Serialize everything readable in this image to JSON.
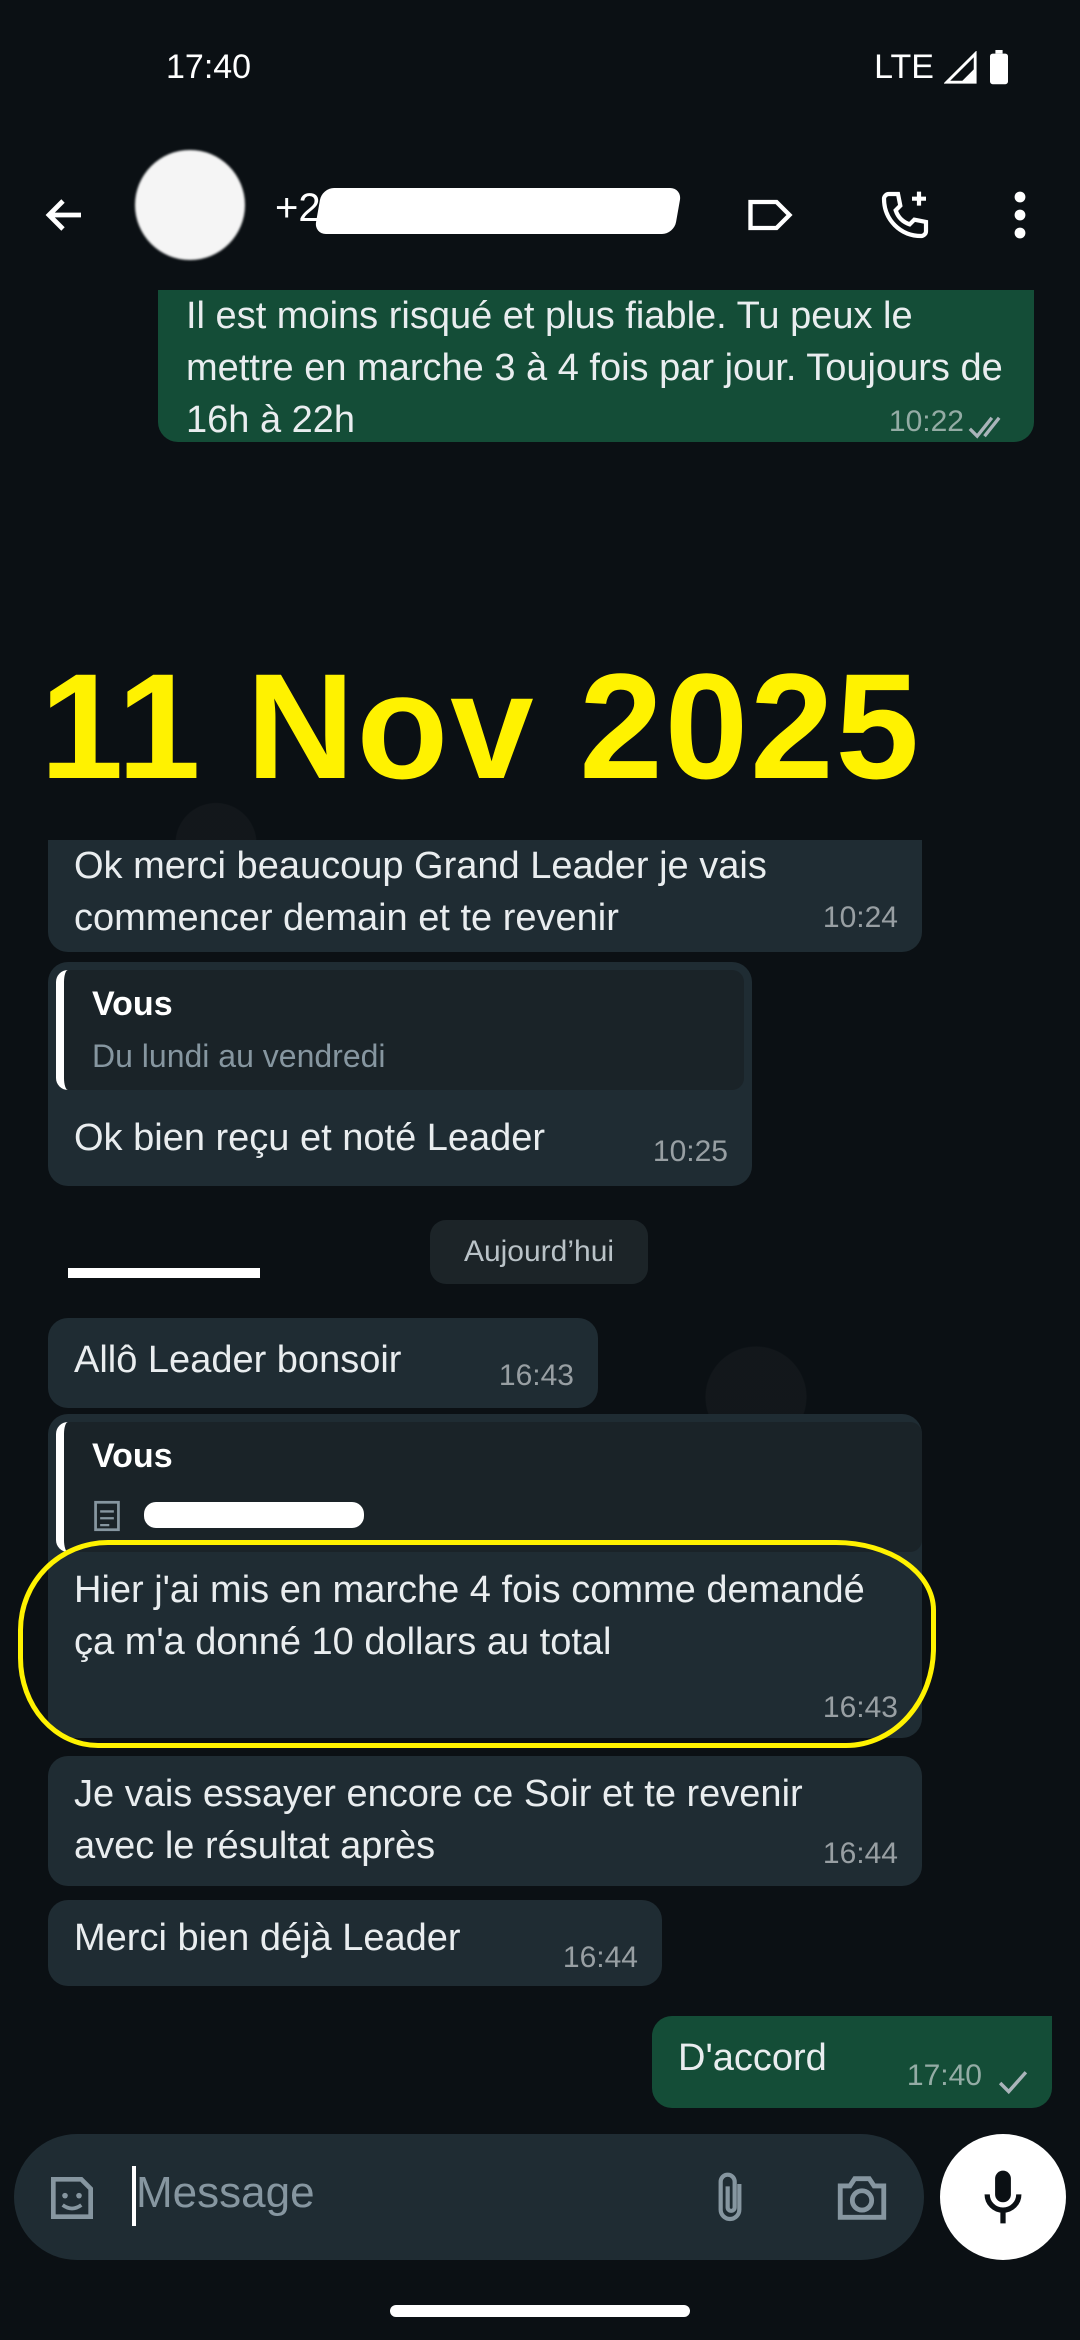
{
  "status": {
    "time": "17:40",
    "network": "LTE"
  },
  "header": {
    "contact_prefix": "+2"
  },
  "messages": {
    "m1": {
      "text": "Il est moins risqué et plus fiable. Tu peux le mettre en marche 3 à 4  fois par jour. Toujours de 16h à 22h",
      "time": "10:22"
    },
    "m2": {
      "text": "Ok merci beaucoup Grand Leader je vais commencer demain et te revenir",
      "time": "10:24"
    },
    "m3": {
      "quote_author": "Vous",
      "quote_text": "Du lundi au vendredi",
      "text": "Ok bien reçu et noté Leader",
      "time": "10:25"
    },
    "m4": {
      "text": "Allô Leader bonsoir",
      "time": "16:43"
    },
    "m5": {
      "quote_author": "Vous",
      "text": "Hier j'ai mis en marche 4 fois comme demandé ça  m'a donné 10 dollars au total",
      "time": "16:43"
    },
    "m6": {
      "text": "Je vais essayer encore ce Soir et te revenir avec le résultat après",
      "time": "16:44"
    },
    "m7": {
      "text": "Merci bien déjà Leader",
      "time": "16:44"
    },
    "m8": {
      "text": "D'accord",
      "time": "17:40"
    }
  },
  "overlay_date": "11 Nov 2025",
  "day_separator": "Aujourd’hui",
  "input": {
    "placeholder": "Message"
  },
  "colors": {
    "incoming": "#1f2c33",
    "outgoing": "#144d37",
    "highlight": "#fff200"
  }
}
